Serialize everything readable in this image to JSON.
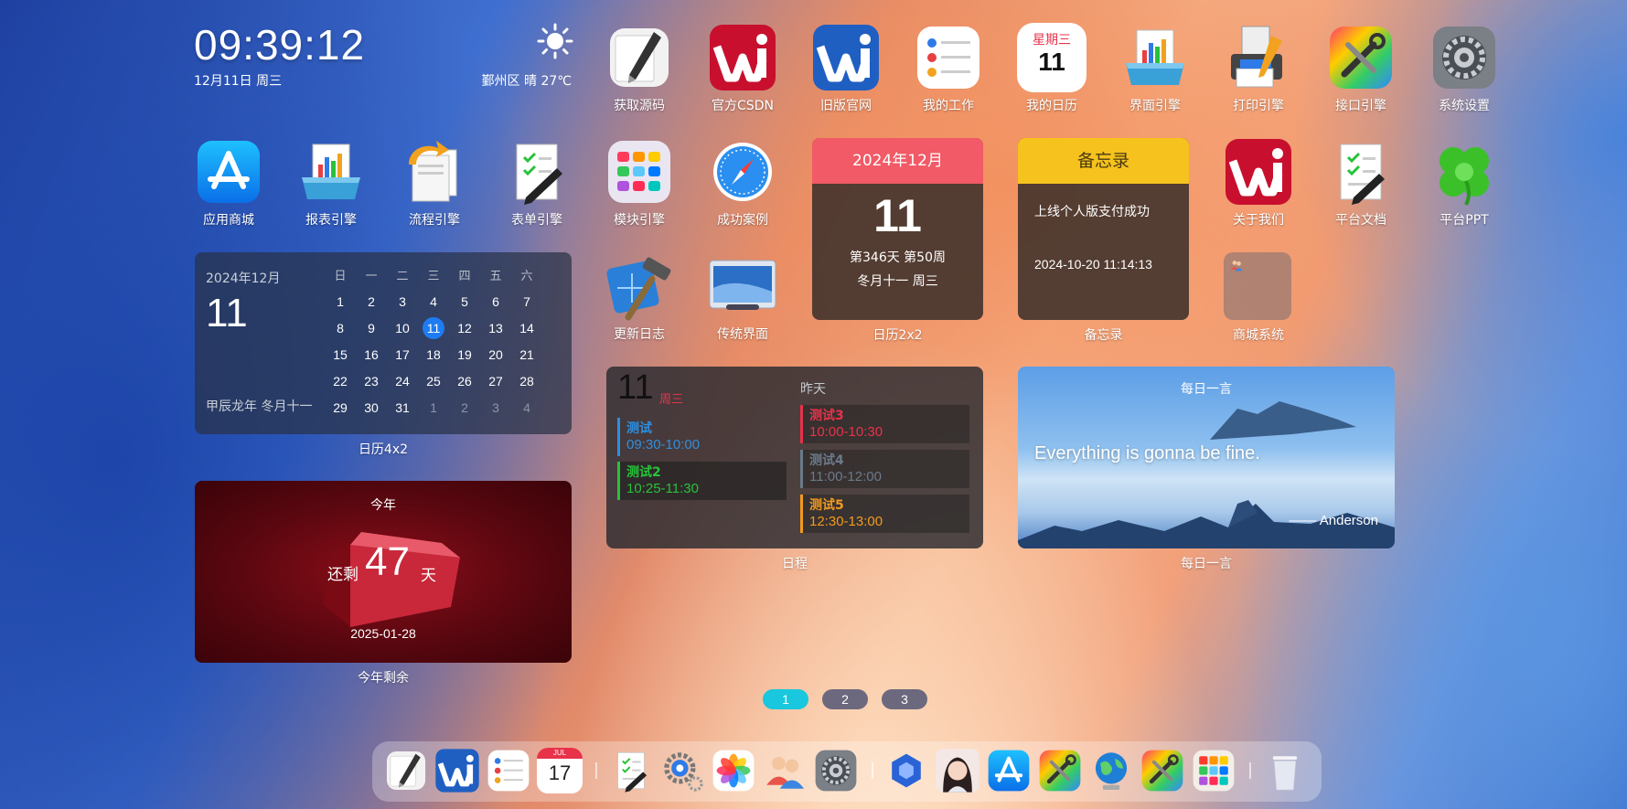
{
  "clock": {
    "time": "09:39:12",
    "date": "12月11日 周三"
  },
  "weather": {
    "text": "鄞州区 晴 27℃",
    "icon": "sun-icon"
  },
  "apps": [
    {
      "label": "获取源码",
      "icon": "pen-icon"
    },
    {
      "label": "官方CSDN",
      "icon": "wi-red-icon"
    },
    {
      "label": "旧版官网",
      "icon": "wi-blue-icon"
    },
    {
      "label": "我的工作",
      "icon": "reminders-icon"
    },
    {
      "label": "我的日历",
      "icon": "calendar-icon",
      "weekday": "星期三",
      "day": "11"
    },
    {
      "label": "界面引擎",
      "icon": "report-tray-icon"
    },
    {
      "label": "打印引擎",
      "icon": "printer-icon"
    },
    {
      "label": "接口引擎",
      "icon": "color-tools-icon"
    },
    {
      "label": "系统设置",
      "icon": "gear-icon"
    },
    {
      "label": "应用商城",
      "icon": "app-store-icon"
    },
    {
      "label": "报表引擎",
      "icon": "report-tray-icon"
    },
    {
      "label": "流程引擎",
      "icon": "flow-doc-icon"
    },
    {
      "label": "表单引擎",
      "icon": "form-doc-icon"
    },
    {
      "label": "模块引擎",
      "icon": "module-grid-icon"
    },
    {
      "label": "成功案例",
      "icon": "compass-icon"
    },
    {
      "label": "关于我们",
      "icon": "wi-red-icon"
    },
    {
      "label": "平台文档",
      "icon": "doc-icon"
    },
    {
      "label": "平台PPT",
      "icon": "clover-icon"
    },
    {
      "label": "更新日志",
      "icon": "hammer-icon"
    },
    {
      "label": "传统界面",
      "icon": "window-icon"
    }
  ],
  "cal4x2": {
    "label": "日历4x2",
    "ym": "2024年12月",
    "day": "11",
    "lunar": "甲辰龙年 冬月十一",
    "headers": [
      "日",
      "一",
      "二",
      "三",
      "四",
      "五",
      "六"
    ],
    "rows": [
      [
        "1",
        "2",
        "3",
        "4",
        "5",
        "6",
        "7"
      ],
      [
        "8",
        "9",
        "10",
        "11",
        "12",
        "13",
        "14"
      ],
      [
        "15",
        "16",
        "17",
        "18",
        "19",
        "20",
        "21"
      ],
      [
        "22",
        "23",
        "24",
        "25",
        "26",
        "27",
        "28"
      ],
      [
        "29",
        "30",
        "31",
        "1",
        "2",
        "3",
        "4"
      ]
    ],
    "today": "11"
  },
  "countdown": {
    "label": "今年剩余",
    "title": "今年",
    "prefix": "还剩",
    "days": "47",
    "unit": "天",
    "date": "2025-01-28"
  },
  "cal2x2": {
    "label": "日历2x2",
    "header": "2024年12月",
    "day": "11",
    "line1": "第346天 第50周",
    "line2": "冬月十一 周三"
  },
  "memo": {
    "label": "备忘录",
    "header": "备忘录",
    "text": "上线个人版支付成功",
    "time": "2024-10-20 11:14:13"
  },
  "mall": {
    "label": "商城系统"
  },
  "schedule": {
    "label": "日程",
    "day": "11",
    "weekday": "周三",
    "yesterday": "昨天",
    "today_events": [
      {
        "name": "测试",
        "time": "09:30-10:00",
        "color": "#2e8fe0"
      },
      {
        "name": "测试2",
        "time": "10:25-11:30",
        "color": "#27c23a"
      }
    ],
    "yesterday_events": [
      {
        "name": "测试3",
        "time": "10:00-10:30",
        "color": "#e8324a"
      },
      {
        "name": "测试4",
        "time": "11:00-12:00",
        "color": "#6a7a8a"
      },
      {
        "name": "测试5",
        "time": "12:30-13:00",
        "color": "#f29a1e"
      }
    ]
  },
  "quote": {
    "label": "每日一言",
    "title": "每日一言",
    "text": "Everything is gonna be fine.",
    "author": "—— Anderson"
  },
  "pager": [
    "1",
    "2",
    "3"
  ],
  "pager_active": "1",
  "dock": [
    "pen-icon",
    "wi-blue-icon",
    "reminders-icon",
    "calendar-icon",
    "doc-icon",
    "gear-cluster-icon",
    "photos-icon",
    "users-icon",
    "gear-icon",
    "cube-icon",
    "avatar-icon",
    "app-store-icon",
    "color-tools-icon",
    "globe-icon",
    "color-tools-icon",
    "launchpad-icon",
    "trash-icon"
  ],
  "dock_calendar": {
    "month": "JUL",
    "day": "17"
  }
}
